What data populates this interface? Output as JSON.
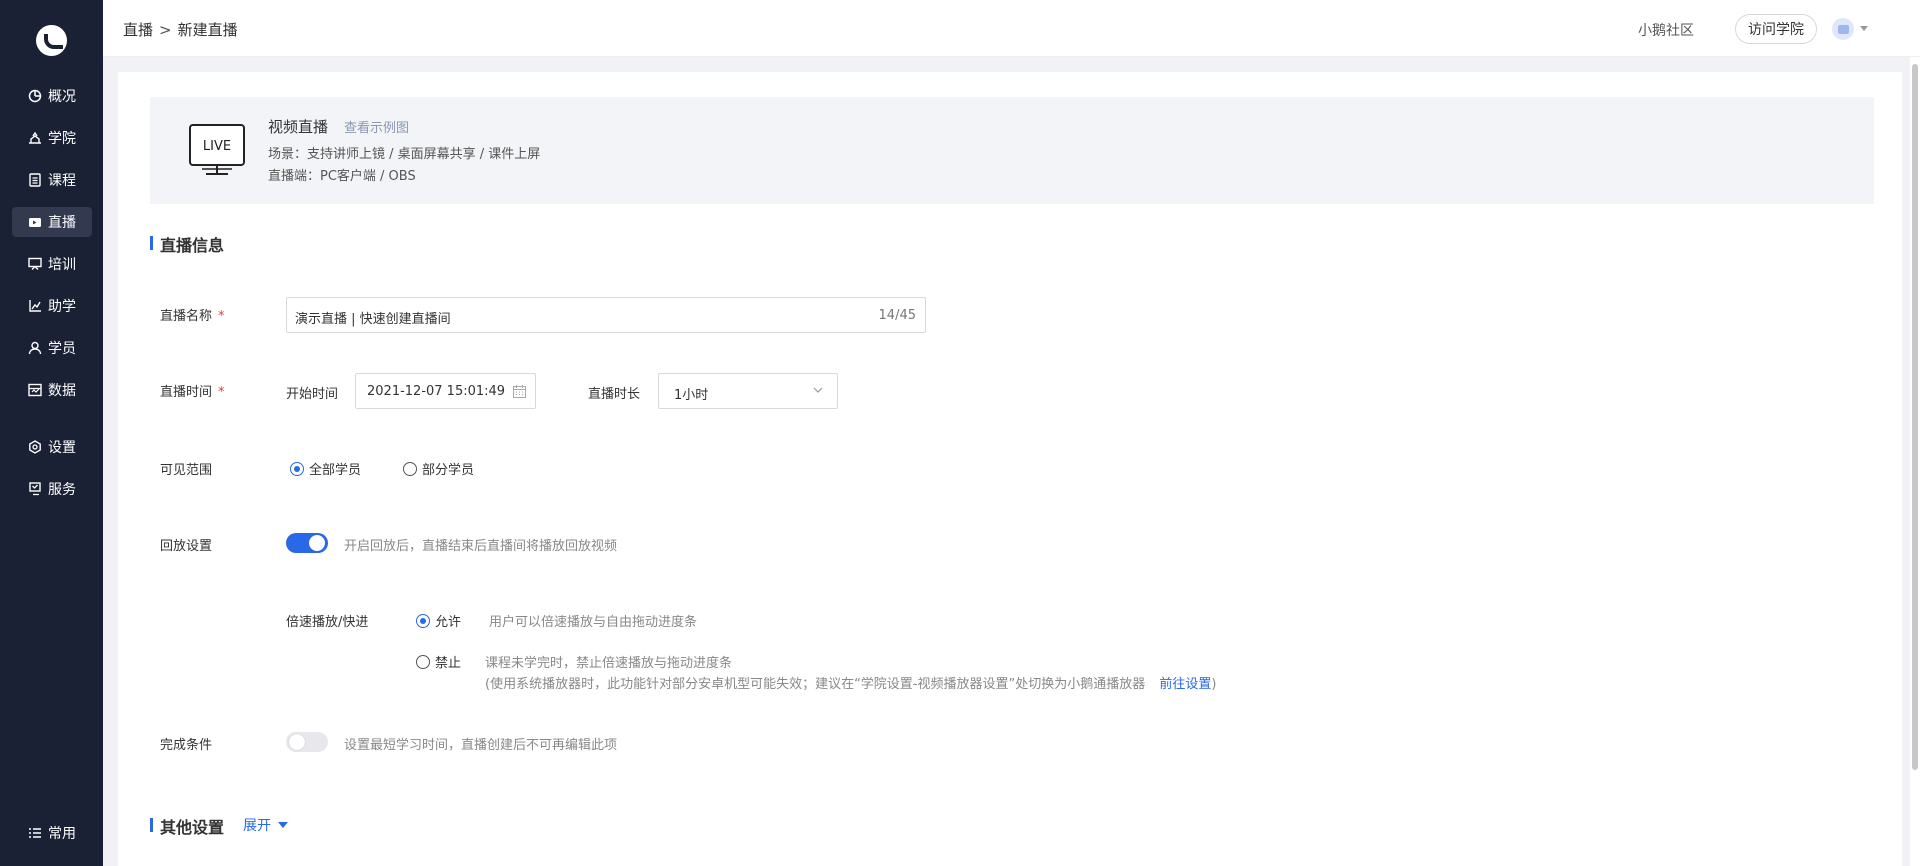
{
  "sidebar": {
    "logo": "logo-icon",
    "items": [
      {
        "label": "概况",
        "icon": "pie-chart-icon",
        "active": false
      },
      {
        "label": "学院",
        "icon": "academy-icon",
        "active": false
      },
      {
        "label": "课程",
        "icon": "course-icon",
        "active": false
      },
      {
        "label": "直播",
        "icon": "live-video-icon",
        "active": true
      },
      {
        "label": "培训",
        "icon": "training-icon",
        "active": false
      },
      {
        "label": "助学",
        "icon": "study-aid-icon",
        "active": false
      },
      {
        "label": "学员",
        "icon": "student-icon",
        "active": false
      },
      {
        "label": "数据",
        "icon": "data-icon",
        "active": false
      },
      {
        "label": "设置",
        "icon": "settings-icon",
        "active": false
      },
      {
        "label": "服务",
        "icon": "service-icon",
        "active": false
      }
    ],
    "bottom": {
      "label": "常用",
      "icon": "menu-list-icon"
    }
  },
  "header": {
    "breadcrumb": {
      "parent": "直播",
      "separator": ">",
      "current": "新建直播"
    },
    "community": "小鹅社区",
    "visit_button": "访问学院",
    "avatar_icon": "avatar-icon",
    "switch_icon": "switch-icon"
  },
  "banner": {
    "icon_text": "LIVE",
    "title": "视频直播",
    "example_link": "查看示例图",
    "scene": "场景：支持讲师上镜 / 桌面屏幕共享 / 课件上屏",
    "client": "直播端：PC客户端 / OBS"
  },
  "form": {
    "section_title": "直播信息",
    "name": {
      "label": "直播名称",
      "required": "*",
      "value": "演示直播 | 快速创建直播间",
      "counter": "14/45"
    },
    "time": {
      "label": "直播时间",
      "required": "*",
      "start_label": "开始时间",
      "start_value": "2021-12-07 15:01:49",
      "duration_label": "直播时长",
      "duration_value": "1小时"
    },
    "visibility": {
      "label": "可见范围",
      "options": [
        {
          "label": "全部学员",
          "checked": true
        },
        {
          "label": "部分学员",
          "checked": false
        }
      ]
    },
    "playback": {
      "label": "回放设置",
      "enabled": true,
      "hint": "开启回放后，直播结束后直播间将播放回放视频"
    },
    "speed": {
      "label": "倍速播放/快进",
      "allow": {
        "label": "允许",
        "checked": true,
        "hint": "用户可以倍速播放与自由拖动进度条"
      },
      "deny": {
        "label": "禁止",
        "checked": false,
        "hint": "课程未学完时，禁止倍速播放与拖动进度条",
        "note": "(使用系统播放器时，此功能针对部分安卓机型可能失效；建议在“学院设置-视频播放器设置”处切换为小鹅通播放器",
        "link": "前往设置",
        "close": ")"
      }
    },
    "completion": {
      "label": "完成条件",
      "enabled": false,
      "hint": "设置最短学习时间，直播创建后不可再编辑此项"
    }
  },
  "other": {
    "section_title": "其他设置",
    "expand": "展开"
  },
  "colors": {
    "sidebar_bg": "#1b2135",
    "accent": "#2968e6",
    "required": "#e63d3d",
    "banner_bg": "#f3f4f7"
  }
}
